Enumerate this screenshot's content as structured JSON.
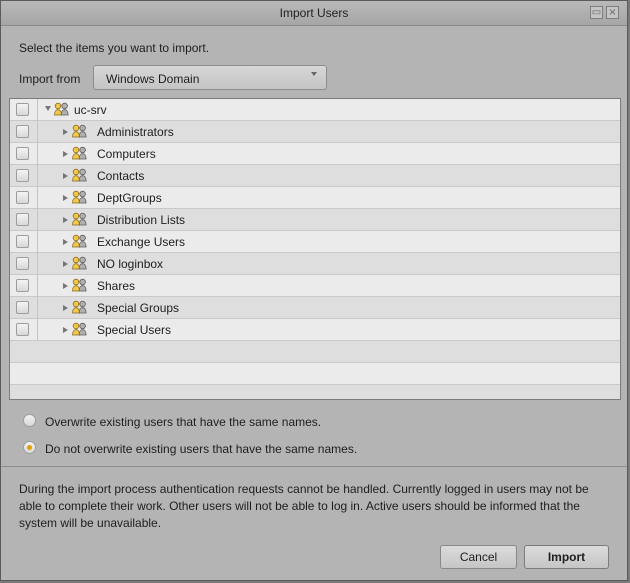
{
  "window": {
    "title": "Import Users",
    "minimize_icon": "minimize-icon",
    "close_icon": "close-icon"
  },
  "main": {
    "instruction": "Select the items you want to import.",
    "import_from_label": "Import from",
    "import_from_value": "Windows Domain"
  },
  "tree": {
    "root": {
      "label": "uc-srv",
      "icon": "group-icon",
      "expanded": true
    },
    "items": [
      "Administrators",
      "Computers",
      "Contacts",
      "DeptGroups",
      "Distribution Lists",
      "Exchange Users",
      "NO loginbox",
      "Shares",
      "Special Groups",
      "Special Users"
    ]
  },
  "options": {
    "overwrite": "Overwrite existing users that have the same names.",
    "no_overwrite": "Do not overwrite existing users that have the same names.",
    "selected": "no_overwrite"
  },
  "notice": "During the import process authentication requests cannot be handled. Currently logged in users may not be able to complete their work. Other users will not be able to log in. Active users should be informed that the system will be unavailable.",
  "buttons": {
    "cancel": "Cancel",
    "import": "Import"
  },
  "colors": {
    "accent": "#e1a100",
    "dialog_bg": "#b4b4b4"
  }
}
